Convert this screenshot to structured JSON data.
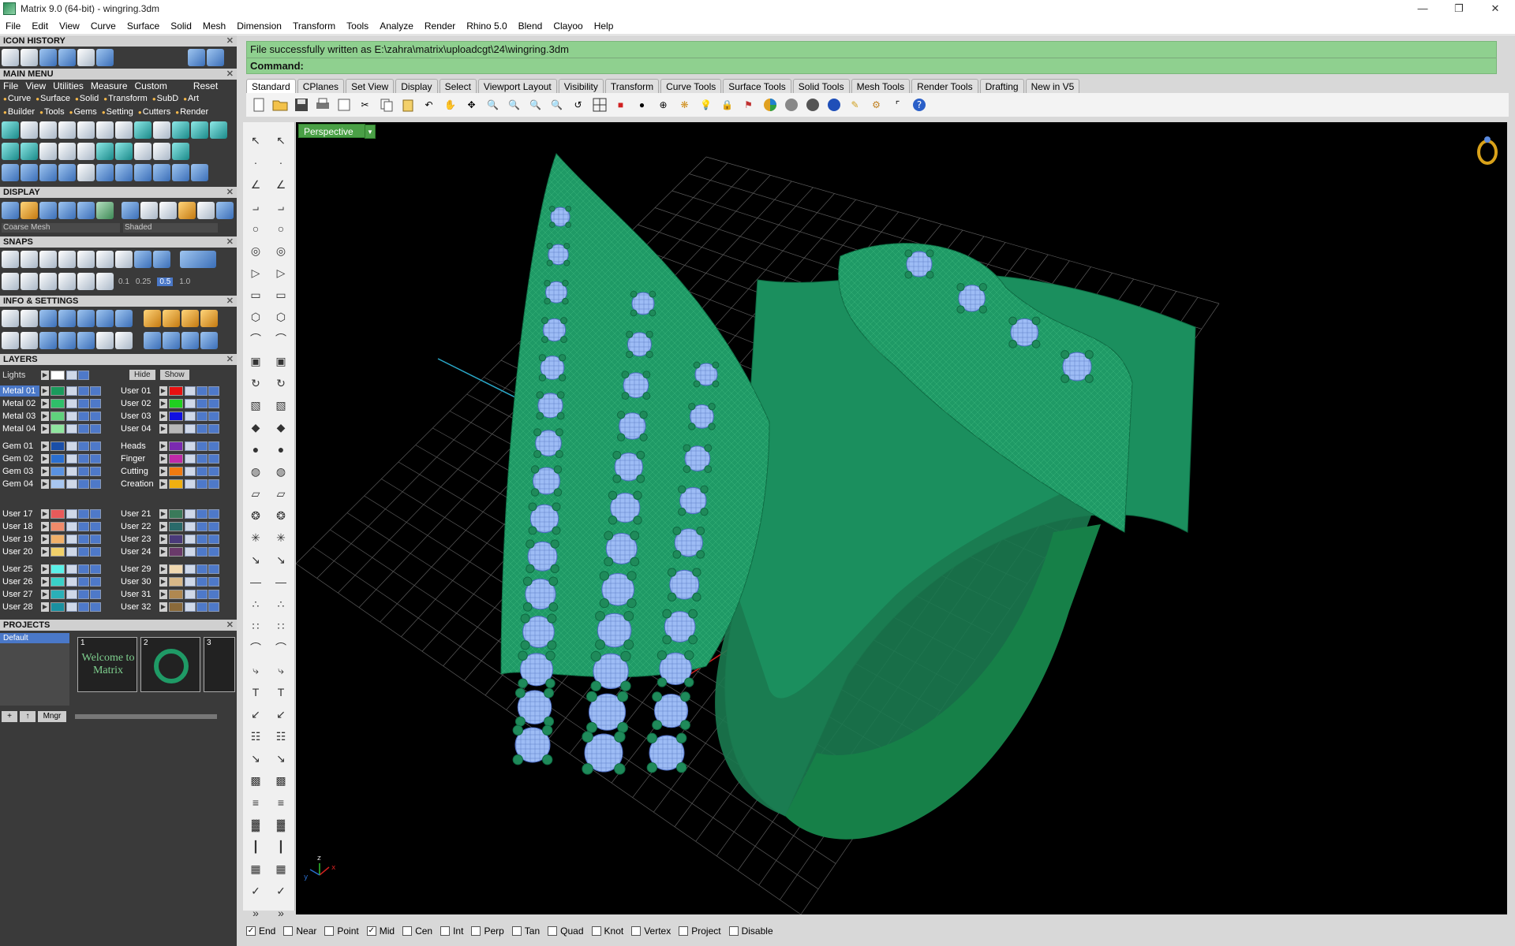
{
  "window": {
    "title": "Matrix 9.0 (64-bit) - wingring.3dm"
  },
  "menubar": [
    "File",
    "Edit",
    "View",
    "Curve",
    "Surface",
    "Solid",
    "Mesh",
    "Dimension",
    "Transform",
    "Tools",
    "Analyze",
    "Render",
    "Rhino 5.0",
    "Blend",
    "Clayoo",
    "Help"
  ],
  "left_panel": {
    "icon_history": "ICON HISTORY",
    "main_menu": "MAIN MENU",
    "main_menu_row": [
      "File",
      "View",
      "Utilities",
      "Measure",
      "Custom",
      "Reset"
    ],
    "main_menu_sub1": [
      "Curve",
      "Surface",
      "Solid",
      "Transform",
      "SubD",
      "Art"
    ],
    "main_menu_sub2": [
      "Builder",
      "Tools",
      "Gems",
      "Setting",
      "Cutters",
      "Render"
    ],
    "display": "DISPLAY",
    "display_mesh": "Coarse Mesh",
    "display_mode": "Shaded",
    "snaps": "SNAPS",
    "snap_values": [
      "0.1",
      "0.25",
      "0.5",
      "1.0"
    ],
    "info_settings": "INFO & SETTINGS",
    "layers": "LAYERS",
    "lights": "Lights",
    "hide": "Hide",
    "show": "Show",
    "layers_left": [
      "Metal 01",
      "Metal 02",
      "Metal 03",
      "Metal 04",
      "Gem 01",
      "Gem 02",
      "Gem 03",
      "Gem 04",
      "User 17",
      "User 18",
      "User 19",
      "User 20",
      "User 25",
      "User 26",
      "User 27",
      "User 28"
    ],
    "layers_left_colors": [
      "#1a9a5c",
      "#2fbf6a",
      "#5fd17c",
      "#8fe59f",
      "#1a4fa8",
      "#2a6fd0",
      "#5a92e0",
      "#a8c6f0",
      "#e85a5a",
      "#f08a6a",
      "#f0b06a",
      "#f0d06a",
      "#5af0e8",
      "#3ad0c8",
      "#2ab0b8",
      "#1a90a0"
    ],
    "layers_right": [
      "User 01",
      "User 02",
      "User 03",
      "User 04",
      "Heads",
      "Finger",
      "Cutting",
      "Creation",
      "User 21",
      "User 22",
      "User 23",
      "User 24",
      "User 29",
      "User 30",
      "User 31",
      "User 32"
    ],
    "layers_right_colors": [
      "#e81010",
      "#20d020",
      "#1010e0",
      "#b8b8b8",
      "#7a2ab0",
      "#c02aa8",
      "#f07a10",
      "#f0b010",
      "#3a7a5a",
      "#2a6a6a",
      "#4a3a7a",
      "#6a3a6a",
      "#f0d8b0",
      "#d8b888",
      "#b08850",
      "#8a6a3a"
    ],
    "projects": "PROJECTS",
    "project_default": "Default",
    "project_thumbs": [
      {
        "num": "1",
        "label": "Welcome to Matrix"
      },
      {
        "num": "2",
        "label": ""
      },
      {
        "num": "3",
        "label": ""
      }
    ],
    "mngr": "Mngr"
  },
  "command": {
    "message": "File successfully written as E:\\zahra\\matrix\\uploadcgt\\24\\wingring.3dm",
    "prompt": "Command:"
  },
  "tabs": [
    "Standard",
    "CPlanes",
    "Set View",
    "Display",
    "Select",
    "Viewport Layout",
    "Visibility",
    "Transform",
    "Curve Tools",
    "Surface Tools",
    "Solid Tools",
    "Mesh Tools",
    "Render Tools",
    "Drafting",
    "New in V5"
  ],
  "viewport": {
    "label": "Perspective"
  },
  "osnaps": [
    {
      "label": "End",
      "checked": true
    },
    {
      "label": "Near",
      "checked": false
    },
    {
      "label": "Point",
      "checked": false
    },
    {
      "label": "Mid",
      "checked": true
    },
    {
      "label": "Cen",
      "checked": false
    },
    {
      "label": "Int",
      "checked": false
    },
    {
      "label": "Perp",
      "checked": false
    },
    {
      "label": "Tan",
      "checked": false
    },
    {
      "label": "Quad",
      "checked": false
    },
    {
      "label": "Knot",
      "checked": false
    },
    {
      "label": "Vertex",
      "checked": false
    },
    {
      "label": "Project",
      "checked": false
    },
    {
      "label": "Disable",
      "checked": false
    }
  ],
  "accent": "#4aa046",
  "command_bg": "#8fd08f",
  "ring_color": "#1f9a66",
  "gem_color": "#9dbcf5"
}
